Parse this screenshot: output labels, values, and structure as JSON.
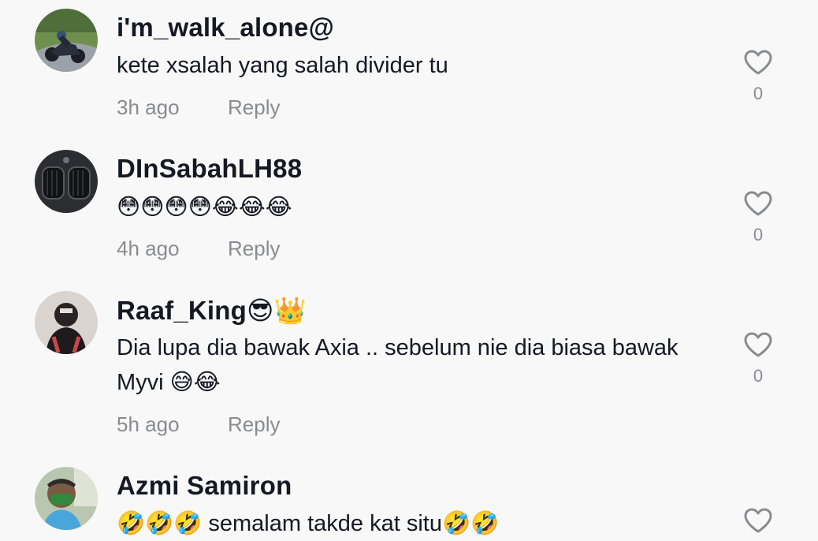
{
  "comments": [
    {
      "username": "i'm_walk_alone@",
      "text": "kete xsalah yang salah divider tu",
      "time": "3h ago",
      "reply_label": "Reply",
      "likes": "0",
      "avatar_icon": "motorcycle-rider-avatar"
    },
    {
      "username": "DInSabahLH88",
      "text": "😳😳😳😳😂😂😂",
      "time": "4h ago",
      "reply_label": "Reply",
      "likes": "0",
      "avatar_icon": "car-grille-avatar"
    },
    {
      "username": "Raaf_King😎👑",
      "text": "Dia lupa dia bawak Axia .. sebelum nie dia biasa bawak Myvi 😅😂",
      "time": "5h ago",
      "reply_label": "Reply",
      "likes": "0",
      "avatar_icon": "person-avatar"
    },
    {
      "username": "Azmi Samiron",
      "text": "🤣🤣🤣 semalam takde kat situ🤣🤣",
      "avatar_icon": "masked-person-avatar"
    }
  ],
  "colors": {
    "background": "#f8f8f8",
    "username": "#161823",
    "text": "#161823",
    "muted": "#8a8b91",
    "heart_outline": "#8a8b91"
  },
  "icons": {
    "like": "heart-outline-icon"
  }
}
